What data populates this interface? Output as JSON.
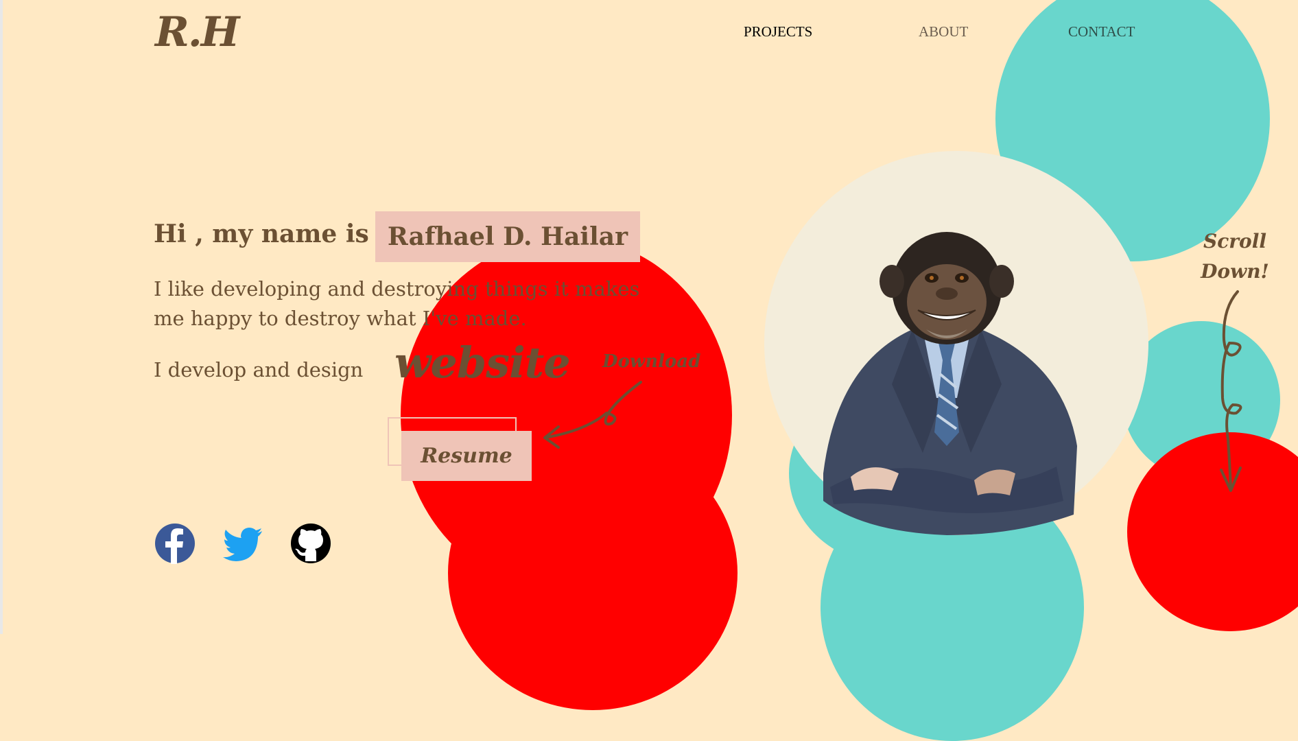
{
  "logo": {
    "text": "R.H"
  },
  "nav": {
    "items": [
      {
        "label": "PROJECTS",
        "color": "#000000"
      },
      {
        "label": "ABOUT",
        "color": "#6b5d4f"
      },
      {
        "label": "CONTACT",
        "color": "#2f4f4a"
      }
    ]
  },
  "hero": {
    "greeting": "Hi , my name is",
    "name": "Rafhael D. Hailar",
    "bio": "I like developing and destroying things it makes me happy to destroy what I've made.",
    "develop_prefix": "I develop and design",
    "develop_word": "website",
    "download_label": "Download",
    "resume_label": "Resume"
  },
  "social": [
    {
      "icon": "facebook-icon",
      "color": "#3b5998"
    },
    {
      "icon": "twitter-icon",
      "color": "#1da1f2"
    },
    {
      "icon": "github-icon",
      "color": "#000000"
    }
  ],
  "scroll_hint": {
    "line1": "Scroll",
    "line2": "Down!"
  },
  "colors": {
    "background": "#ffe9c4",
    "text": "#6b5033",
    "accent_pink": "#efc4b7",
    "teal": "#69d6cc",
    "red": "#ff0000",
    "cream": "#f3eddb"
  }
}
